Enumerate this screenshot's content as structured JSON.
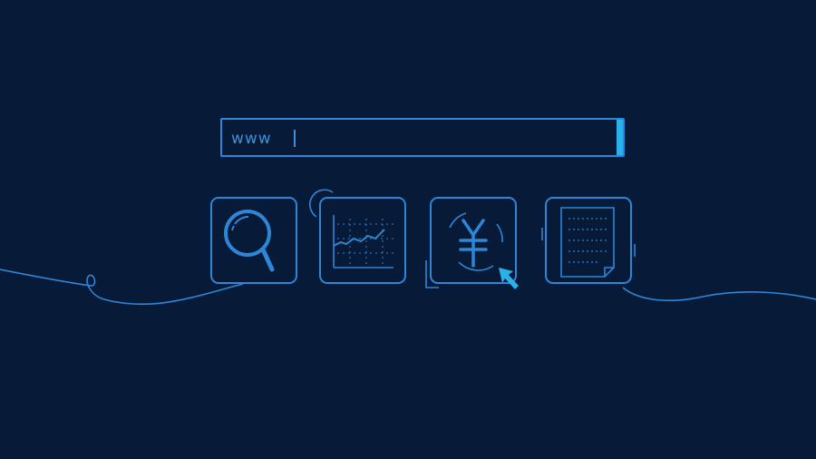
{
  "search": {
    "prefix": "www",
    "value": ""
  },
  "tiles": [
    {
      "name": "search-tile",
      "icon": "magnifier-icon"
    },
    {
      "name": "chart-tile",
      "icon": "line-chart-icon"
    },
    {
      "name": "payment-tile",
      "icon": "yuan-icon"
    },
    {
      "name": "document-tile",
      "icon": "document-icon"
    }
  ],
  "colors": {
    "background": "#071a38",
    "stroke": "#2e86d6",
    "accent": "#2ab0ea"
  }
}
